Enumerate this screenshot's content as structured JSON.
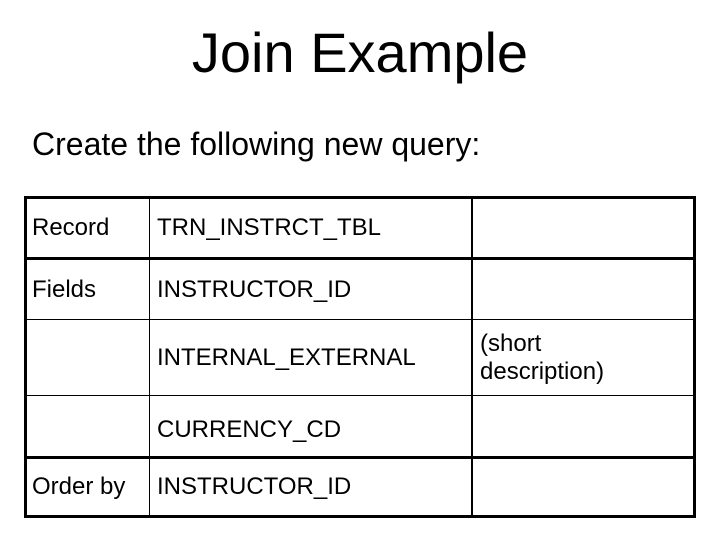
{
  "slide": {
    "title": "Join Example",
    "subtitle": "Create the following new query:"
  },
  "table": {
    "rows": [
      {
        "label": "Record",
        "value": "TRN_INSTRCT_TBL",
        "note": ""
      },
      {
        "label": "Fields",
        "value": "INSTRUCTOR_ID",
        "note": ""
      },
      {
        "label": "",
        "value": "INTERNAL_EXTERNAL",
        "note_line1": "(short",
        "note_line2": "description)"
      },
      {
        "label": "",
        "value": "CURRENCY_CD",
        "note": ""
      },
      {
        "label": "Order by",
        "value": "INSTRUCTOR_ID",
        "note": ""
      }
    ]
  }
}
